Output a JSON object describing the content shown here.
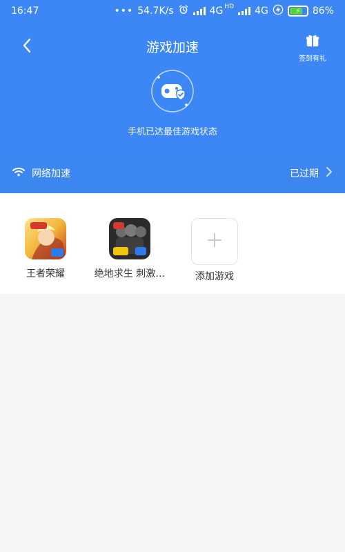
{
  "status_bar": {
    "time": "16:47",
    "network_speed": "54.7K/s",
    "net_a": "4G",
    "hd": "HD",
    "net_b": "4G",
    "battery": "86%",
    "icons": [
      "dots-icon",
      "alarm-icon",
      "signal-icon",
      "signal-icon",
      "bolt-icon",
      "battery-icon"
    ]
  },
  "header": {
    "title": "游戏加速",
    "gift_label": "签到有礼",
    "status_text": "手机已达最佳游戏状态",
    "icons": {
      "back": "chevron-left-icon",
      "gift": "gift-icon",
      "hero": "gamepad-shield-icon"
    }
  },
  "network": {
    "label": "网络加速",
    "status": "已过期",
    "icons": {
      "left": "wifi-icon",
      "right": "chevron-right-icon"
    }
  },
  "games": {
    "items": [
      {
        "label": "王者荣耀"
      },
      {
        "label": "绝地求生 刺激…"
      }
    ],
    "add_label": "添加游戏"
  },
  "colors": {
    "header_bg": "#3c87f5",
    "network_bg": "#3b86ef",
    "page_bg": "#f5f5f5",
    "white": "#ffffff"
  }
}
